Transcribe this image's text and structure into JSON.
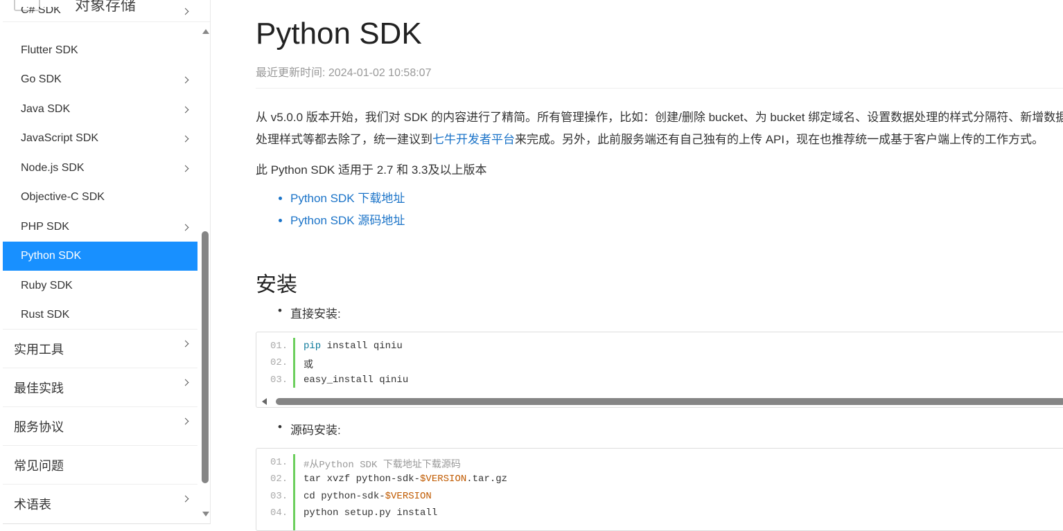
{
  "sidebar": {
    "header_title": "对象存储",
    "partial_top_label": "C# SDK",
    "sub_items": [
      {
        "label": "Flutter SDK",
        "has_children": false
      },
      {
        "label": "Go SDK",
        "has_children": true
      },
      {
        "label": "Java SDK",
        "has_children": true
      },
      {
        "label": "JavaScript SDK",
        "has_children": true
      },
      {
        "label": "Node.js SDK",
        "has_children": true
      },
      {
        "label": "Objective-C SDK",
        "has_children": false
      },
      {
        "label": "PHP SDK",
        "has_children": true
      },
      {
        "label": "Python SDK",
        "has_children": false,
        "active": true
      },
      {
        "label": "Ruby SDK",
        "has_children": false
      },
      {
        "label": "Rust SDK",
        "has_children": false
      }
    ],
    "top_items": [
      {
        "label": "实用工具",
        "has_children": true
      },
      {
        "label": "最佳实践",
        "has_children": true
      },
      {
        "label": "服务协议",
        "has_children": true
      },
      {
        "label": "常见问题",
        "has_children": false
      },
      {
        "label": "术语表",
        "has_children": true
      }
    ]
  },
  "main": {
    "title": "Python SDK",
    "updated": "最近更新时间: 2024-01-02 10:58:07",
    "intro_line1": "从 v5.0.0 版本开始，我们对 SDK 的内容进行了精简。所有管理操作，比如：创建/删除 bucket、为 bucket 绑定域名、设置数据处理的样式分隔符、新增数据",
    "intro_line2_pre": "处理样式等都去除了，统一建议到",
    "intro_link": "七牛开发者平台",
    "intro_line2_post": "来完成。另外，此前服务端还有自己独有的上传 API，现在也推荐统一成基于客户端上传的工作方式。",
    "version_note": "此 Python SDK 适用于 2.7 和 3.3及以上版本",
    "links": [
      "Python SDK 下载地址",
      "Python SDK 源码地址"
    ],
    "install_heading": "安装",
    "direct_install_label": "直接安装:",
    "source_install_label": "源码安装:",
    "code1": {
      "line_numbers": [
        "01.",
        "02.",
        "03."
      ],
      "l1_kw": "pip",
      "l1_rest": " install qiniu",
      "l2": "或",
      "l3": "easy_install qiniu"
    },
    "code2": {
      "line_numbers": [
        "01.",
        "02.",
        "03.",
        "04."
      ],
      "l1": "#从Python SDK 下载地址下载源码",
      "l2_pre": "tar xvzf python-sdk-",
      "l2_var": "$VERSION",
      "l2_post": ".tar.gz",
      "l3_pre": "cd python-sdk-",
      "l3_var": "$VERSION",
      "l4": "python setup.py install"
    }
  },
  "colors": {
    "active_bg": "#1890ff",
    "link": "#1a73c8",
    "code_gutter": "#6ccf5d",
    "code_keyword": "#0d7a9b",
    "code_variable": "#c05a00"
  }
}
